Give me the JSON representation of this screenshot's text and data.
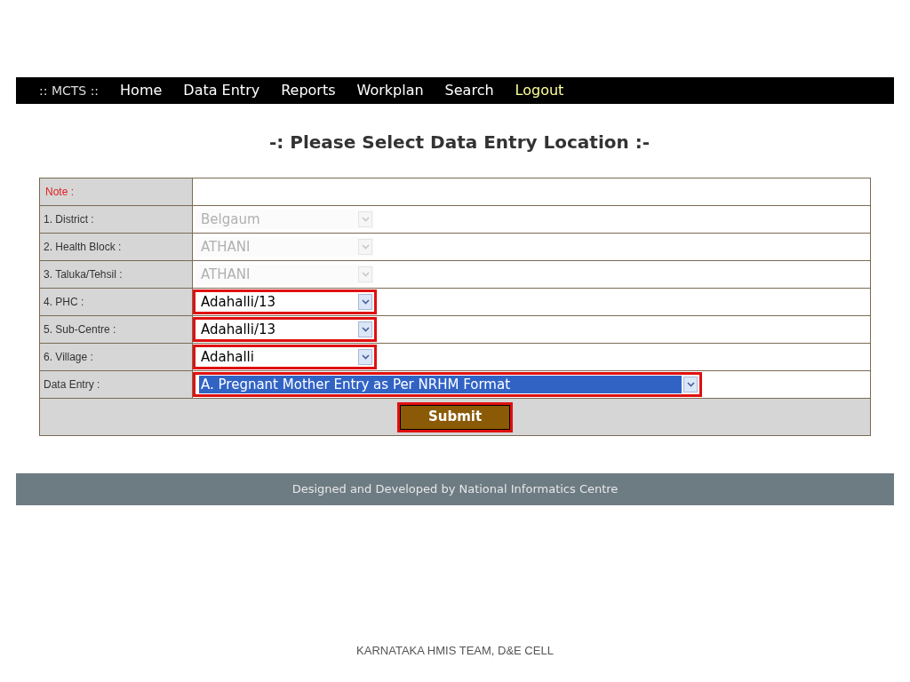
{
  "nav": {
    "brand": ":: MCTS ::",
    "items": [
      {
        "label": "Home",
        "color": "#ffffff"
      },
      {
        "label": "Data Entry",
        "color": "#ffffff"
      },
      {
        "label": "Reports",
        "color": "#ffffff"
      },
      {
        "label": "Workplan",
        "color": "#ffffff"
      },
      {
        "label": "Search",
        "color": "#ffffff"
      },
      {
        "label": "Logout",
        "color": "#ffff99"
      }
    ]
  },
  "title": "-: Please Select Data Entry Location :-",
  "note_label": "Note :",
  "rows": [
    {
      "label": "1. District :",
      "value": "Belgaum",
      "kind": "short",
      "disabled": true,
      "highlighted": false,
      "focused": false
    },
    {
      "label": "2. Health Block :",
      "value": "ATHANI",
      "kind": "short",
      "disabled": true,
      "highlighted": false,
      "focused": false
    },
    {
      "label": "3. Taluka/Tehsil :",
      "value": "ATHANI",
      "kind": "short",
      "disabled": true,
      "highlighted": false,
      "focused": false
    },
    {
      "label": "4. PHC :",
      "value": "Adahalli/13",
      "kind": "short",
      "disabled": false,
      "highlighted": true,
      "focused": false
    },
    {
      "label": "5. Sub-Centre :",
      "value": "Adahalli/13",
      "kind": "short",
      "disabled": false,
      "highlighted": true,
      "focused": false
    },
    {
      "label": "6. Village :",
      "value": "Adahalli",
      "kind": "short",
      "disabled": false,
      "highlighted": true,
      "focused": false
    },
    {
      "label": "Data Entry :",
      "value": "A. Pregnant Mother Entry as Per NRHM Format",
      "kind": "wide",
      "disabled": false,
      "highlighted": true,
      "focused": true
    }
  ],
  "submit": {
    "label": "Submit",
    "highlighted": true
  },
  "footer": "Designed and Developed by National Informatics Centre",
  "slide_footer": "KARNATAKA HMIS TEAM, D&E CELL"
}
